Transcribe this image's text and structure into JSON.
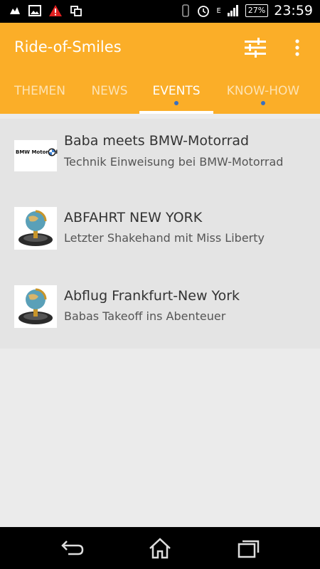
{
  "status_bar": {
    "time": "23:59",
    "battery": "27%",
    "network": "E",
    "icons": [
      "recycle-icon",
      "image-icon",
      "warning-icon",
      "screen-icon",
      "vibrate-icon",
      "alarm-icon",
      "signal-icon",
      "battery-icon"
    ]
  },
  "app_bar": {
    "title": "Ride-of-Smiles",
    "tabs": [
      {
        "label": "THEMEN",
        "active": false,
        "has_dot": false
      },
      {
        "label": "NEWS",
        "active": false,
        "has_dot": false
      },
      {
        "label": "EVENTS",
        "active": true,
        "has_dot": true
      },
      {
        "label": "KNOW-HOW",
        "active": false,
        "has_dot": true
      }
    ]
  },
  "items": [
    {
      "title": "Baba meets BMW-Motorrad",
      "subtitle": "Technik Einweisung bei BMW-Motorrad",
      "thumb_text": "BMW Motorrad"
    },
    {
      "title": "ABFAHRT  NEW YORK",
      "subtitle": "Letzter Shakehand mit Miss Liberty"
    },
    {
      "title": "Abflug  Frankfurt-New York",
      "subtitle": "Babas Takeoff ins Abenteuer"
    }
  ],
  "colors": {
    "app_bar": "#fbae28",
    "tab_dot": "#3a6fbf",
    "list_bg": "#e4e4e4",
    "page_bg": "#ebebeb"
  }
}
